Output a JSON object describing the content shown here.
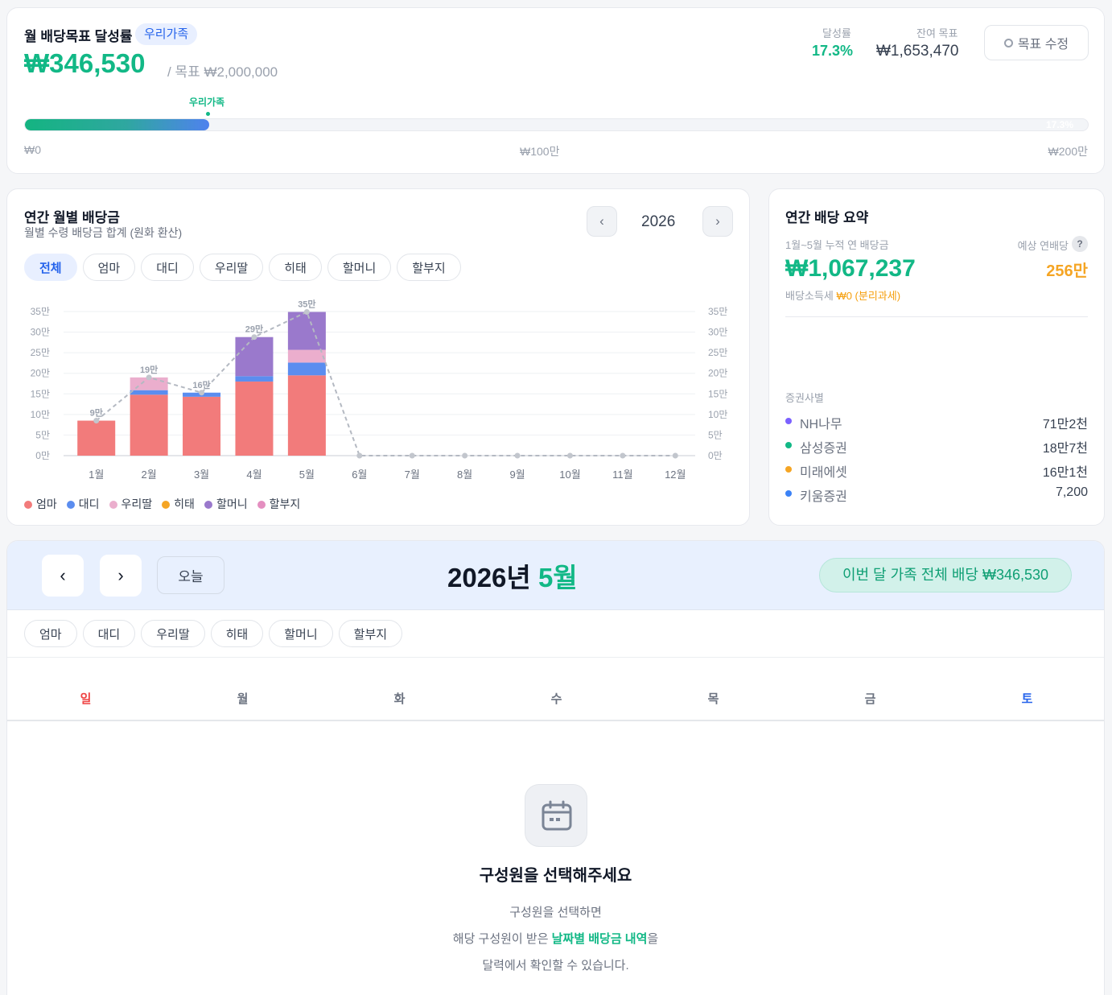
{
  "goal": {
    "title": "월 배당목표 달성률",
    "badge": "우리가족",
    "amount": "₩346,530",
    "target": "/ 목표 ₩2,000,000",
    "rate_label": "달성률",
    "rate_value": "17.3%",
    "remain_label": "잔여 목표",
    "remain_value": "₩1,653,470",
    "edit_button": "목표 수정",
    "edit_icon": "gear-icon",
    "marker_label": "우리가족",
    "progress_fraction": 0.173,
    "progress_text": "17.3%",
    "scale": [
      "₩0",
      "₩100만",
      "₩200만"
    ]
  },
  "annual": {
    "title": "연간 월별 배당금",
    "subtitle": "월별 수령 배당금 합계 (원화 환산)",
    "year": "2026",
    "prev": "‹",
    "next": "›",
    "tabs": [
      "전체",
      "엄마",
      "대디",
      "우리딸",
      "히태",
      "할머니",
      "할부지"
    ],
    "active_tab": "전체"
  },
  "chart_data": {
    "type": "bar",
    "stacked": true,
    "categories": [
      "1월",
      "2월",
      "3월",
      "4월",
      "5월",
      "6월",
      "7월",
      "8월",
      "9월",
      "10월",
      "11월",
      "12월"
    ],
    "series": [
      {
        "name": "엄마",
        "color": "#f27b7b",
        "values": [
          8.5,
          14.8,
          14.3,
          18.0,
          19.5,
          0,
          0,
          0,
          0,
          0,
          0,
          0
        ]
      },
      {
        "name": "대디",
        "color": "#5b8def",
        "values": [
          0,
          1.1,
          1.0,
          1.3,
          3.1,
          0,
          0,
          0,
          0,
          0,
          0,
          0
        ]
      },
      {
        "name": "우리딸",
        "color": "#ebaecd",
        "values": [
          0,
          3.1,
          0,
          0,
          3.1,
          0,
          0,
          0,
          0,
          0,
          0,
          0
        ]
      },
      {
        "name": "히태",
        "color": "#f5a524",
        "values": [
          0,
          0,
          0,
          0,
          0,
          0,
          0,
          0,
          0,
          0,
          0,
          0
        ]
      },
      {
        "name": "할머니",
        "color": "#9a79cc",
        "values": [
          0,
          0,
          0,
          9.5,
          9.2,
          0,
          0,
          0,
          0,
          0,
          0,
          0
        ]
      },
      {
        "name": "할부지",
        "color": "#e48fc0",
        "values": [
          0,
          0,
          0,
          0,
          0,
          0,
          0,
          0,
          0,
          0,
          0,
          0
        ]
      }
    ],
    "totals": [
      8.5,
      19,
      15.3,
      28.8,
      34.9,
      0,
      0,
      0,
      0,
      0,
      0,
      0
    ],
    "total_labels": [
      "9만",
      "19만",
      "16만",
      "29만",
      "35만",
      "",
      "",
      "",
      "",
      "",
      "",
      ""
    ],
    "y_ticks": [
      "0만",
      "5만",
      "10만",
      "15만",
      "20만",
      "25만",
      "30만",
      "35만"
    ],
    "ylim": [
      0,
      35
    ],
    "y_unit": "만원",
    "legend": "bottom",
    "grid": true
  },
  "summary": {
    "title": "연간 배당 요약",
    "accum_label": "1월~5월 누적 연 배당금",
    "accum_value": "₩1,067,237",
    "expected_label": "예상 연배당",
    "help": "?",
    "expected_value": "256만",
    "tax_label": "배당소득세",
    "tax_value": "₩0 (분리과세)",
    "broker_title": "증권사별",
    "brokers": [
      {
        "name": "NH나무",
        "value": "71만2천",
        "color": "#7b61ff"
      },
      {
        "name": "삼성증권",
        "value": "18만7천",
        "color": "#12b886"
      },
      {
        "name": "미래에셋",
        "value": "16만1천",
        "color": "#f5a524"
      },
      {
        "name": "키움증권",
        "value": "7,200",
        "color": "#3b82f6"
      }
    ]
  },
  "calendar": {
    "prev": "‹",
    "next": "›",
    "today": "오늘",
    "year_text": "2026년",
    "month_text": "5월",
    "total_badge": "이번 달 가족 전체 배당 ₩346,530",
    "members": [
      "엄마",
      "대디",
      "우리딸",
      "히태",
      "할머니",
      "할부지"
    ],
    "weekdays": [
      "일",
      "월",
      "화",
      "수",
      "목",
      "금",
      "토"
    ],
    "empty_icon": "calendar-icon",
    "empty_title": "구성원을 선택해주세요",
    "empty_line1": "구성원을 선택하면",
    "empty_line2_a": "해당 구성원이 받은 ",
    "empty_line2_b": "날짜별 배당금 내역",
    "empty_line2_c": "을",
    "empty_line3": "달력에서 확인할 수 있습니다."
  },
  "colors": {
    "accent_green": "#12b886",
    "accent_blue": "#2563eb",
    "orange": "#f59e0b",
    "sunday": "#ef4444",
    "saturday": "#2563eb"
  }
}
